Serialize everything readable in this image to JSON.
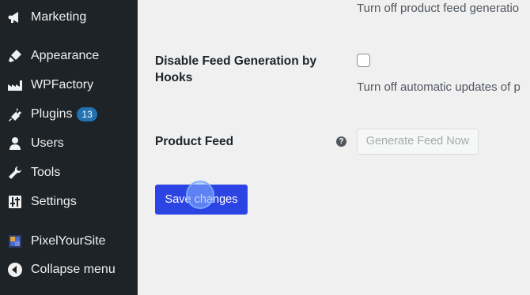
{
  "sidebar": {
    "items": [
      {
        "label": "Marketing",
        "icon": "megaphone-icon"
      },
      {
        "label": "Appearance",
        "icon": "paintbrush-icon"
      },
      {
        "label": "WPFactory",
        "icon": "factory-icon"
      },
      {
        "label": "Plugins",
        "icon": "plugin-icon",
        "badge": "13"
      },
      {
        "label": "Users",
        "icon": "user-icon"
      },
      {
        "label": "Tools",
        "icon": "wrench-icon"
      },
      {
        "label": "Settings",
        "icon": "settings-sliders-icon"
      },
      {
        "label": "PixelYourSite",
        "icon": "pixelyoursite-logo-icon"
      },
      {
        "label": "Collapse menu",
        "icon": "collapse-arrow-icon"
      }
    ]
  },
  "settings": {
    "top_desc": "Turn off product feed generatio",
    "hooks_label": "Disable Feed Generation by Hooks",
    "hooks_checked": false,
    "hooks_desc": "Turn off automatic updates of p",
    "feed_label": "Product Feed",
    "help_glyph": "?",
    "generate_button": "Generate Feed Now"
  },
  "actions": {
    "save_label": "Save changes"
  },
  "colors": {
    "sidebar_bg": "#1d2327",
    "badge": "#2271b1",
    "save_button": "#2c44e3",
    "page_bg": "#f0f0f1"
  }
}
